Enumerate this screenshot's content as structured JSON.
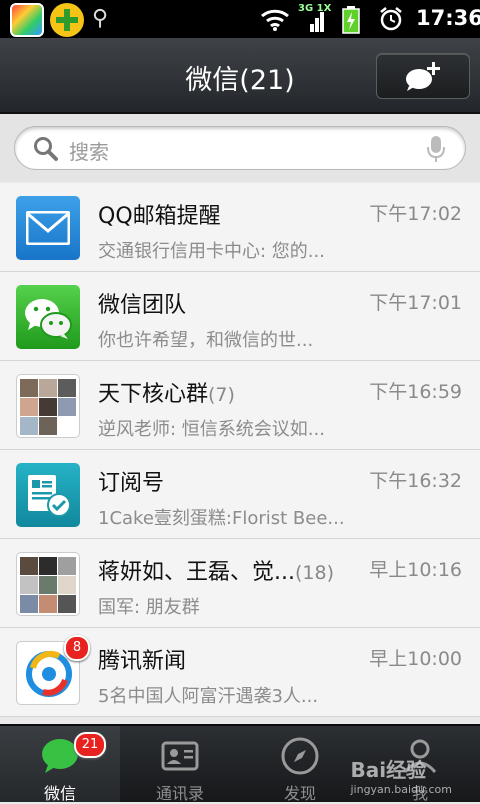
{
  "status_bar": {
    "network": "3G 1X",
    "time": "17:36",
    "icons": [
      "app-store-icon",
      "plus-app-icon",
      "usb-icon",
      "wifi-icon",
      "signal-icon",
      "battery-charging-icon",
      "alarm-icon"
    ]
  },
  "header": {
    "title": "微信(21)",
    "compose_icon": "new-chat-icon"
  },
  "search": {
    "placeholder": "搜索",
    "icons": [
      "search-icon",
      "microphone-icon"
    ]
  },
  "chats": [
    {
      "name": "QQ邮箱提醒",
      "count": "",
      "time": "下午17:02",
      "preview": "交通银行信用卡中心: 您的...",
      "avatar": "mail-icon"
    },
    {
      "name": "微信团队",
      "count": "",
      "time": "下午17:01",
      "preview": "你也许希望，和微信的世...",
      "avatar": "wechat-logo-icon"
    },
    {
      "name": "天下核心群",
      "count": "(7)",
      "time": "下午16:59",
      "preview": "逆风老师: 恒信系统会议如...",
      "avatar": "group-avatar"
    },
    {
      "name": "订阅号",
      "count": "",
      "time": "下午16:32",
      "preview": "1Cake壹刻蛋糕:Florist Bee...",
      "avatar": "subscription-icon"
    },
    {
      "name": "蒋妍如、王磊、觉...",
      "count": "(18)",
      "time": "早上10:16",
      "preview": "国军: 朋友群",
      "avatar": "group-avatar"
    },
    {
      "name": "腾讯新闻",
      "count": "",
      "time": "早上10:00",
      "preview": "5名中国人阿富汗遇袭3人...",
      "avatar": "tencent-news-icon",
      "badge": "8"
    }
  ],
  "tabs": [
    {
      "label": "微信",
      "icon": "chat-bubble-icon",
      "badge": "21",
      "active": true
    },
    {
      "label": "通讯录",
      "icon": "contacts-card-icon"
    },
    {
      "label": "发现",
      "icon": "compass-icon"
    },
    {
      "label": "我",
      "icon": "person-icon"
    }
  ],
  "watermark": {
    "text": "Bai经验",
    "sub": "jingyan.baidu.com"
  },
  "colors": {
    "badge": "#e8231f",
    "titlebar": "#2f3236",
    "tabbar": "#1f2124",
    "wechat_green": "#1f9a1c"
  }
}
